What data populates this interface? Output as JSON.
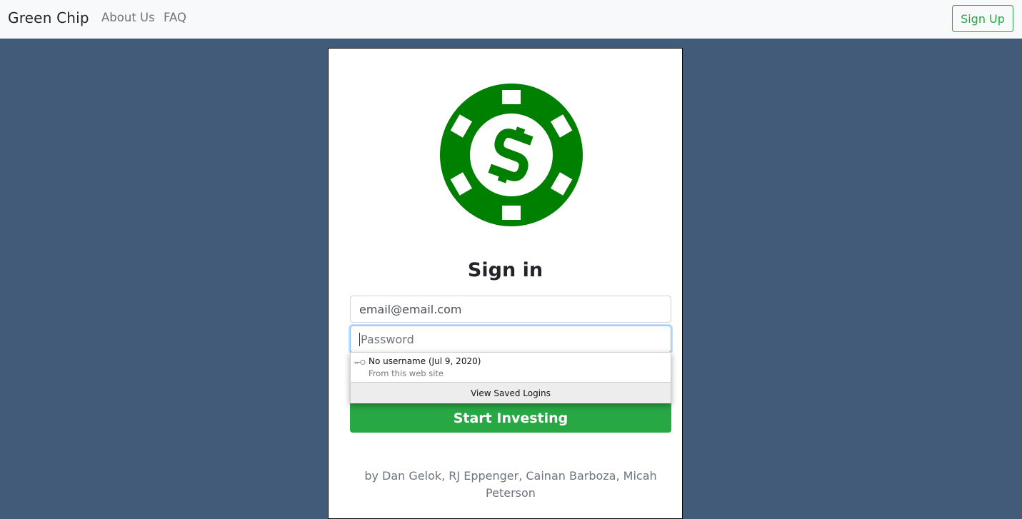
{
  "navbar": {
    "brand": "Green Chip",
    "links": [
      "About Us",
      "FAQ"
    ],
    "signup_label": "Sign Up"
  },
  "signin": {
    "title": "Sign in",
    "email_value": "email@email.com",
    "password_placeholder": "Password",
    "submit_label": "Start Investing",
    "credits": "by Dan Gelok, RJ Eppenger, Cainan Barboza, Micah Peterson"
  },
  "autofill": {
    "entry_title": "No username (Jul 9, 2020)",
    "entry_subtitle": "From this web site",
    "view_saved": "View Saved Logins"
  },
  "colors": {
    "brand_green": "#008000",
    "button_green": "#28a745",
    "page_background": "#425b78"
  },
  "icons": [
    "poker-chip-dollar-logo",
    "key-icon"
  ]
}
